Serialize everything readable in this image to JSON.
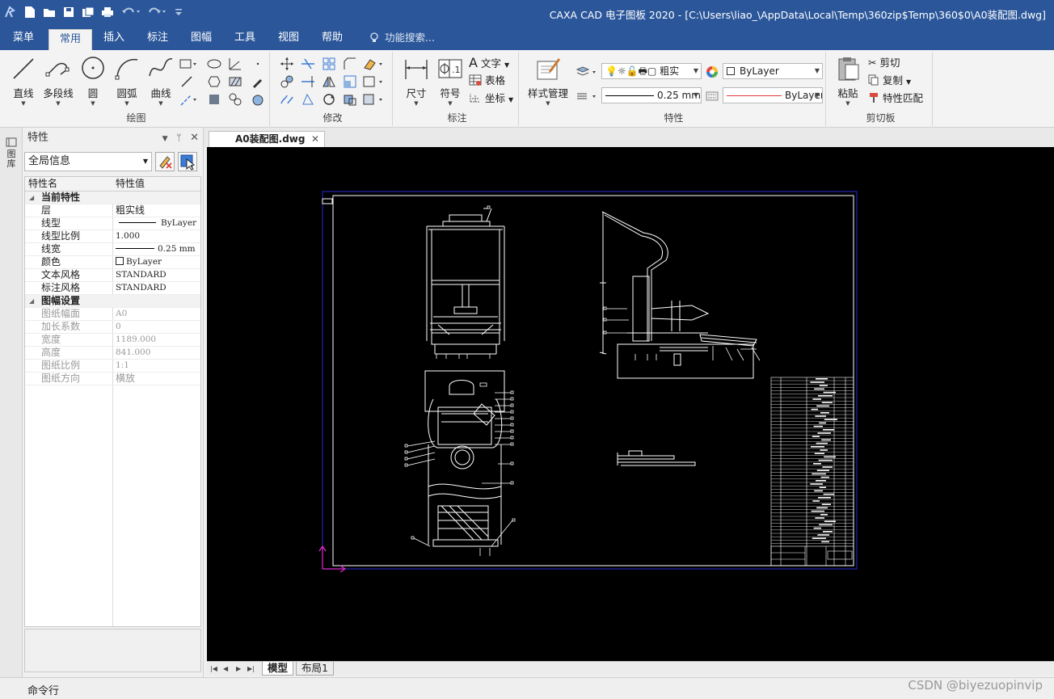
{
  "window": {
    "title": "CAXA CAD 电子图板 2020 - [C:\\Users\\liao_\\AppData\\Local\\Temp\\360zip$Temp\\360$0\\A0装配图.dwg]",
    "accent_color": "#2b579a"
  },
  "quick_access_icons": [
    "app-logo-icon",
    "new-file-icon",
    "open-file-icon",
    "save-icon",
    "save-all-icon",
    "print-icon",
    "undo-icon",
    "redo-icon",
    "customize-icon"
  ],
  "menu": {
    "items": [
      "菜单",
      "常用",
      "插入",
      "标注",
      "图幅",
      "工具",
      "视图",
      "帮助"
    ],
    "active": "常用",
    "search_label": "功能搜索..."
  },
  "ribbon": {
    "draw": {
      "group_label": "绘图",
      "line": "直线",
      "polyline": "多段线",
      "circle": "圆",
      "arc": "圆弧",
      "curve": "曲线"
    },
    "modify": {
      "group_label": "修改"
    },
    "dimension": {
      "group_label": "标注",
      "size": "尺寸",
      "symbol": "符号",
      "text": "文字",
      "table": "表格",
      "coordinate": "坐标"
    },
    "properties": {
      "group_label": "特性",
      "style_manager": "样式管理",
      "layer_value": "粗实",
      "color_value": "ByLayer",
      "linewidth_value": "0.25 mm",
      "linetype_value": "ByLayer"
    },
    "clipboard": {
      "group_label": "剪切板",
      "paste": "粘贴",
      "cut": "剪切",
      "copy": "复制",
      "match": "特性匹配"
    }
  },
  "side_strip": {
    "label": "图库"
  },
  "properties_panel": {
    "title": "特性",
    "selector": "全局信息",
    "col_name": "特性名",
    "col_value": "特性值",
    "section_current": "当前特性",
    "current": [
      {
        "name": "层",
        "value": "粗实线"
      },
      {
        "name": "线型",
        "value": "ByLayer"
      },
      {
        "name": "线型比例",
        "value": "1.000"
      },
      {
        "name": "线宽",
        "value": "0.25 mm"
      },
      {
        "name": "颜色",
        "value": "ByLayer"
      },
      {
        "name": "文本风格",
        "value": "STANDARD"
      },
      {
        "name": "标注风格",
        "value": "STANDARD"
      }
    ],
    "section_sheet": "图幅设置",
    "sheet": [
      {
        "name": "图纸幅面",
        "value": "A0"
      },
      {
        "name": "加长系数",
        "value": "0"
      },
      {
        "name": "宽度",
        "value": "1189.000"
      },
      {
        "name": "高度",
        "value": "841.000"
      },
      {
        "name": "图纸比例",
        "value": "1:1"
      },
      {
        "name": "图纸方向",
        "value": "横放"
      }
    ]
  },
  "document": {
    "tab": "A0装配图.dwg"
  },
  "layout_tabs": [
    "模型",
    "布局1"
  ],
  "command_line": {
    "label": "命令行"
  },
  "watermark": "CSDN @biyezuopinvip"
}
